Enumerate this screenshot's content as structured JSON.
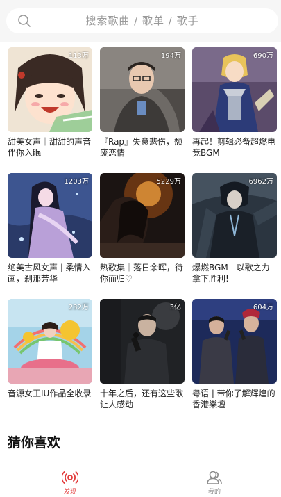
{
  "search": {
    "placeholder": "搜索歌曲 / 歌单 / 歌手"
  },
  "playlists": [
    {
      "title": "甜美女声｜甜甜的声音伴你入眠",
      "play_count": "113万"
    },
    {
      "title": "『Rap』失意悲伤，颓废恋情",
      "play_count": "194万"
    },
    {
      "title": "再起！剪辑必备超燃电竞BGM",
      "play_count": "690万"
    },
    {
      "title": "绝美古风女声 | 柔情入画，刹那芳华",
      "play_count": "1203万"
    },
    {
      "title": "热歌集｜落日余晖，待你而归♡",
      "play_count": "5229万"
    },
    {
      "title": "爆燃BGM｜以歌之力拿下胜利!",
      "play_count": "6962万"
    },
    {
      "title": "音源女王IU作品全收录",
      "play_count": "232万"
    },
    {
      "title": "十年之后，还有这些歌让人感动",
      "play_count": "3亿"
    },
    {
      "title": "粤语 | 带你了解辉煌的香港樂壇",
      "play_count": "604万"
    }
  ],
  "section": {
    "title": "猜你喜欢"
  },
  "bottom_nav": {
    "discover_label": "发现",
    "mine_label": "我的",
    "active_color": "#e23a3a",
    "inactive_color": "#888888"
  }
}
